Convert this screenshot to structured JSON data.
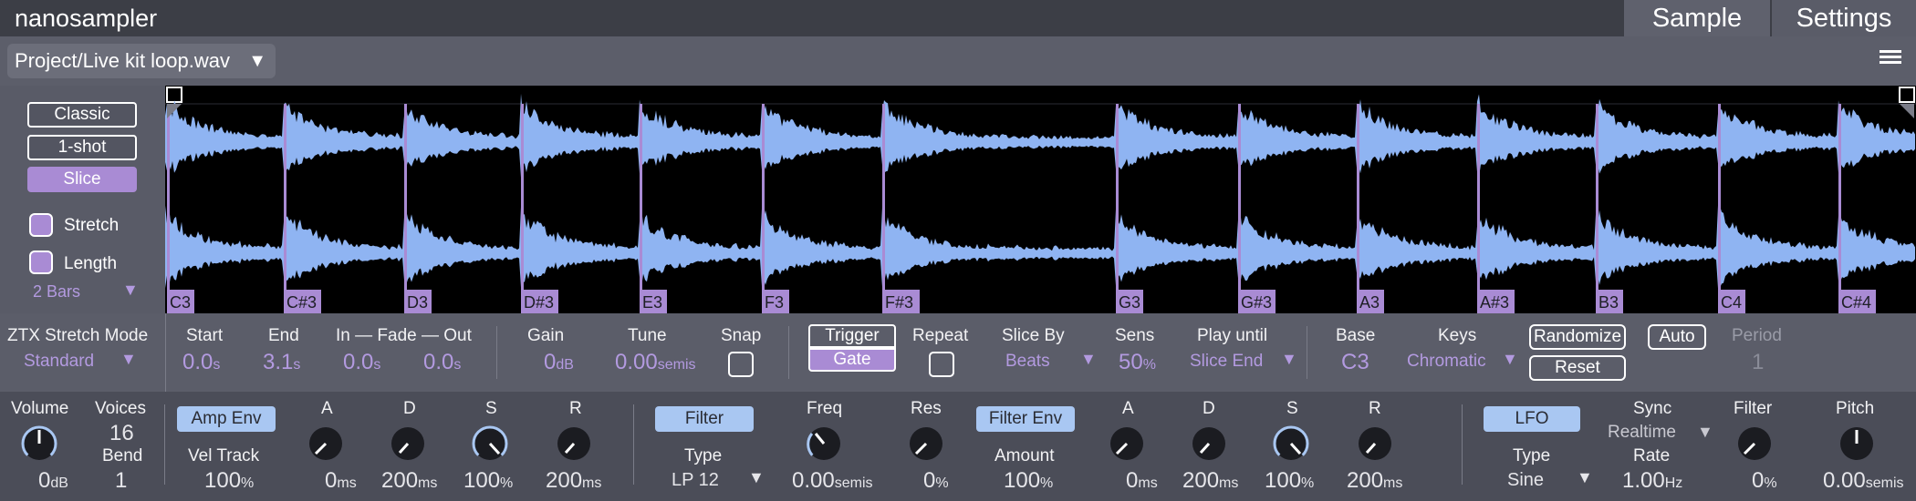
{
  "app": {
    "title": "nanosampler"
  },
  "tabs": [
    {
      "label": "Sample"
    },
    {
      "label": "Settings"
    }
  ],
  "file": {
    "path": "Project/Live kit loop.wav",
    "arrow": "▼"
  },
  "modes": [
    {
      "label": "Classic"
    },
    {
      "label": "1-shot"
    },
    {
      "label": "Slice"
    }
  ],
  "checks": {
    "stretch": "Stretch",
    "length": "Length"
  },
  "length_value": "2 Bars",
  "ztx": {
    "label": "ZTX Stretch Mode",
    "value": "Standard"
  },
  "slices": [
    "C3",
    "C#3",
    "D3",
    "D#3",
    "E3",
    "F3",
    "F#3",
    "G3",
    "G#3",
    "A3",
    "A#3",
    "B3",
    "C4",
    "C#4"
  ],
  "params": {
    "start": {
      "label": "Start",
      "value": "0.0",
      "unit": "s"
    },
    "end": {
      "label": "End",
      "value": "3.1",
      "unit": "s"
    },
    "fade_label": "In — Fade — Out",
    "fade_in": {
      "value": "0.0",
      "unit": "s"
    },
    "fade_out": {
      "value": "0.0",
      "unit": "s"
    },
    "gain": {
      "label": "Gain",
      "value": "0",
      "unit": "dB"
    },
    "tune": {
      "label": "Tune",
      "value": "0.00",
      "unit": "semis"
    },
    "snap": {
      "label": "Snap"
    },
    "trigger": "Trigger",
    "gate": "Gate",
    "repeat": {
      "label": "Repeat"
    },
    "slice_by": {
      "label": "Slice By",
      "value": "Beats"
    },
    "sens": {
      "label": "Sens",
      "value": "50",
      "unit": "%"
    },
    "play_until": {
      "label": "Play until",
      "value": "Slice End"
    },
    "base": {
      "label": "Base",
      "value": "C3"
    },
    "keys": {
      "label": "Keys",
      "value": "Chromatic"
    },
    "randomize": "Randomize",
    "auto": "Auto",
    "reset": "Reset",
    "period": {
      "label": "Period",
      "value": "1"
    }
  },
  "bottom": {
    "volume": {
      "label": "Volume",
      "value": "0",
      "unit": "dB"
    },
    "voices": {
      "label": "Voices",
      "value": "16"
    },
    "bend": {
      "label": "Bend",
      "value": "1"
    },
    "amp_env": "Amp Env",
    "vel_track": {
      "label": "Vel Track",
      "value": "100",
      "unit": "%"
    },
    "amp": {
      "a": {
        "label": "A",
        "value": "0",
        "unit": "ms"
      },
      "d": {
        "label": "D",
        "value": "200",
        "unit": "ms"
      },
      "s": {
        "label": "S",
        "value": "100",
        "unit": "%"
      },
      "r": {
        "label": "R",
        "value": "200",
        "unit": "ms"
      }
    },
    "filter": "Filter",
    "filter_type": {
      "label": "Type",
      "value": "LP 12"
    },
    "freq": {
      "label": "Freq",
      "value": "0.00",
      "unit": "semis"
    },
    "res": {
      "label": "Res",
      "value": "0",
      "unit": "%"
    },
    "filter_env": "Filter Env",
    "amount": {
      "label": "Amount",
      "value": "100",
      "unit": "%"
    },
    "fenv": {
      "a": {
        "label": "A",
        "value": "0",
        "unit": "ms"
      },
      "d": {
        "label": "D",
        "value": "200",
        "unit": "ms"
      },
      "s": {
        "label": "S",
        "value": "100",
        "unit": "%"
      },
      "r": {
        "label": "R",
        "value": "200",
        "unit": "ms"
      }
    },
    "lfo": "LFO",
    "lfo_type": {
      "label": "Type",
      "value": "Sine"
    },
    "sync": {
      "label": "Sync",
      "value": "Realtime"
    },
    "rate": {
      "label": "Rate",
      "value": "1.00",
      "unit": "Hz"
    },
    "lfo_filter": {
      "label": "Filter",
      "value": "0",
      "unit": "%"
    },
    "pitch": {
      "label": "Pitch",
      "value": "0.00",
      "unit": "semis"
    }
  },
  "colors": {
    "accent": "#a98bd4",
    "wave": "#8fb4f2",
    "pill": "#a9c7f2",
    "bg": "#525460"
  }
}
